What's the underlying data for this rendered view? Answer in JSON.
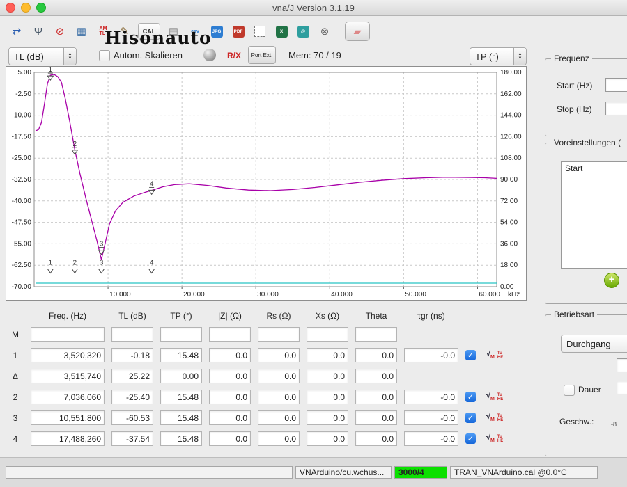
{
  "window": {
    "title": "vna/J Version 3.1.19"
  },
  "watermark": "Hisonauto",
  "toolbar": {
    "icons": [
      {
        "name": "reconnect-icon",
        "glyph": "⇄",
        "fg": "#2a5db0"
      },
      {
        "name": "antenna-icon",
        "glyph": "Ψ",
        "fg": "#4a5a6a"
      },
      {
        "name": "single-sweep-icon",
        "glyph": "⊘",
        "fg": "#cc2222"
      },
      {
        "name": "frequency-table-icon",
        "glyph": "▦",
        "fg": "#3a6ea5"
      },
      {
        "name": "scale-select-icon",
        "glyph": "AM\nTL",
        "fg": "#cc2222",
        "tiny": true
      },
      {
        "name": "calibration-icon",
        "glyph": "✎",
        "fg": "#8a6d3b"
      },
      {
        "name": "cal-button",
        "glyph": "CAL",
        "fg": "#222",
        "boxed": true
      },
      {
        "name": "report-icon",
        "glyph": "▤",
        "fg": "#888888"
      },
      {
        "name": "csv-export-icon",
        "glyph": "csv",
        "fg": "#2d7dd2",
        "tiny": true
      },
      {
        "name": "jpg-export-icon",
        "glyph": "JPG",
        "fg": "#ffffff",
        "bg": "#2d7dd2"
      },
      {
        "name": "pdf-export-icon",
        "glyph": "PDF",
        "fg": "#ffffff",
        "bg": "#c0392b"
      },
      {
        "name": "snapshot-icon",
        "glyph": "",
        "fg": "#555555",
        "dashed": true
      },
      {
        "name": "xls-export-icon",
        "glyph": "X",
        "fg": "#ffffff",
        "bg": "#217346"
      },
      {
        "name": "xml-export-icon",
        "glyph": "@",
        "fg": "#ffffff",
        "bg": "#2e9e9e"
      },
      {
        "name": "zoom-reset-icon",
        "glyph": "⊗",
        "fg": "#666666"
      },
      {
        "name": "eraser-icon",
        "glyph": "▰",
        "fg": "#dd8888",
        "big": true
      }
    ]
  },
  "controls": {
    "left_scale": "TL (dB)",
    "autoscale_label": "Autom. Skalieren",
    "rx_icon": "R/X",
    "port_ext_label": "Port Ext.",
    "mem_label": "Mem: 70 / 19",
    "right_scale": "TP (°)"
  },
  "chart_data": {
    "type": "line",
    "x_axis": {
      "ticks": [
        "10.000",
        "20.000",
        "30.000",
        "40.000",
        "50.000",
        "60.000"
      ],
      "unit": "kHz",
      "min": 0,
      "max": 62.6
    },
    "y_left": {
      "label": "TL (dB)",
      "ticks": [
        "5.00",
        "-2.50",
        "-10.00",
        "-17.50",
        "-25.00",
        "-32.50",
        "-40.00",
        "-47.50",
        "-55.00",
        "-62.50",
        "-70.00"
      ],
      "min": -70,
      "max": 5
    },
    "y_right": {
      "label": "TP (°)",
      "ticks": [
        "180.00",
        "162.00",
        "144.00",
        "126.00",
        "108.00",
        "90.00",
        "72.00",
        "54.00",
        "36.00",
        "18.00",
        "0.00"
      ],
      "min": 0,
      "max": 180
    },
    "grid": true,
    "series": [
      {
        "name": "TL (dB)",
        "axis": "left",
        "color": "#a800a8",
        "points": [
          [
            0.2,
            -15.5
          ],
          [
            0.6,
            -15
          ],
          [
            1.0,
            -12.5
          ],
          [
            1.4,
            -6
          ],
          [
            1.8,
            1
          ],
          [
            2.2,
            4
          ],
          [
            2.7,
            4.3
          ],
          [
            3.2,
            3.5
          ],
          [
            3.7,
            1.5
          ],
          [
            4.2,
            -4
          ],
          [
            4.8,
            -12
          ],
          [
            5.5,
            -22
          ],
          [
            6.2,
            -30.5
          ],
          [
            7.0,
            -39
          ],
          [
            7.8,
            -47
          ],
          [
            8.5,
            -54
          ],
          [
            9.1,
            -60.5
          ],
          [
            9.6,
            -55
          ],
          [
            10.2,
            -48
          ],
          [
            11.0,
            -43.5
          ],
          [
            12.0,
            -40.5
          ],
          [
            13.5,
            -38.3
          ],
          [
            15.0,
            -37
          ],
          [
            15.9,
            -36.3
          ],
          [
            17.5,
            -35
          ],
          [
            19.0,
            -34.3
          ],
          [
            21.0,
            -34
          ],
          [
            23.5,
            -34.6
          ],
          [
            26.0,
            -35.5
          ],
          [
            29.0,
            -36.2
          ],
          [
            32.0,
            -36.4
          ],
          [
            35.0,
            -36
          ],
          [
            38.0,
            -35.3
          ],
          [
            41.0,
            -34.4
          ],
          [
            44.0,
            -33.5
          ],
          [
            47.0,
            -32.8
          ],
          [
            50.0,
            -32.2
          ],
          [
            53.0,
            -31.9
          ],
          [
            56.0,
            -31.7
          ],
          [
            59.0,
            -31.8
          ],
          [
            61.0,
            -31.9
          ],
          [
            62.6,
            -32.1
          ]
        ]
      },
      {
        "name": "TP (°)",
        "axis": "right",
        "color": "#27c3c3",
        "points": [
          [
            0.2,
            2.9
          ],
          [
            62.6,
            2.9
          ]
        ]
      }
    ],
    "markers": [
      {
        "n": "1",
        "axis": "left",
        "x": 2.2,
        "y": 4.0
      },
      {
        "n": "2",
        "axis": "left",
        "x": 5.5,
        "y": -22
      },
      {
        "n": "3",
        "axis": "left",
        "x": 9.1,
        "y": -57
      },
      {
        "n": "4",
        "axis": "left",
        "x": 15.9,
        "y": -36
      },
      {
        "n": "1",
        "axis": "right",
        "x": 2.2,
        "y": 15.48
      },
      {
        "n": "2",
        "axis": "right",
        "x": 5.5,
        "y": 15.48
      },
      {
        "n": "3",
        "axis": "right",
        "x": 9.1,
        "y": 15.48
      },
      {
        "n": "4",
        "axis": "right",
        "x": 15.9,
        "y": 15.48
      }
    ]
  },
  "table": {
    "headers": [
      "Freq. (Hz)",
      "TL (dB)",
      "TP (°)",
      "|Z| (Ω)",
      "Rs (Ω)",
      "Xs (Ω)",
      "Theta",
      "τgr (ns)"
    ],
    "row_icons": [
      "√M",
      "Tu\nHE"
    ],
    "rows": [
      {
        "label": "M",
        "values": [
          "",
          "",
          "",
          "",
          "",
          "",
          ""
        ],
        "checkbox": false
      },
      {
        "label": "1",
        "values": [
          "3,520,320",
          "-0.18",
          "15.48",
          "0.0",
          "0.0",
          "0.0",
          "0.0",
          "-0.0"
        ],
        "checkbox": true
      },
      {
        "label": "Δ",
        "values": [
          "3,515,740",
          "25.22",
          "0.00",
          "0.0",
          "0.0",
          "0.0",
          "0.0"
        ],
        "checkbox": false
      },
      {
        "label": "2",
        "values": [
          "7,036,060",
          "-25.40",
          "15.48",
          "0.0",
          "0.0",
          "0.0",
          "0.0",
          "-0.0"
        ],
        "checkbox": true
      },
      {
        "label": "3",
        "values": [
          "10,551,800",
          "-60.53",
          "15.48",
          "0.0",
          "0.0",
          "0.0",
          "0.0",
          "-0.0"
        ],
        "checkbox": true
      },
      {
        "label": "4",
        "values": [
          "17,488,260",
          "-37.54",
          "15.48",
          "0.0",
          "0.0",
          "0.0",
          "0.0",
          "-0.0"
        ],
        "checkbox": true
      }
    ]
  },
  "right_panel": {
    "frequenz": {
      "title": "Frequenz",
      "start_label": "Start (Hz)",
      "stop_label": "Stop (Hz)",
      "start_value": "",
      "stop_value": ""
    },
    "presets": {
      "title": "Voreinstellungen (",
      "items": [
        "Start"
      ],
      "add_button": "+"
    },
    "betriebsart": {
      "title": "Betriebsart",
      "mode_value": "Durchgang",
      "dauer_label": "Dauer",
      "geschw_label": "Geschw.:",
      "scale_text": "-8"
    }
  },
  "statusbar": {
    "message": "",
    "port": "VNArduino/cu.wchus...",
    "counter": "3000/4",
    "calibration": "TRAN_VNArduino.cal @0.0°C"
  }
}
